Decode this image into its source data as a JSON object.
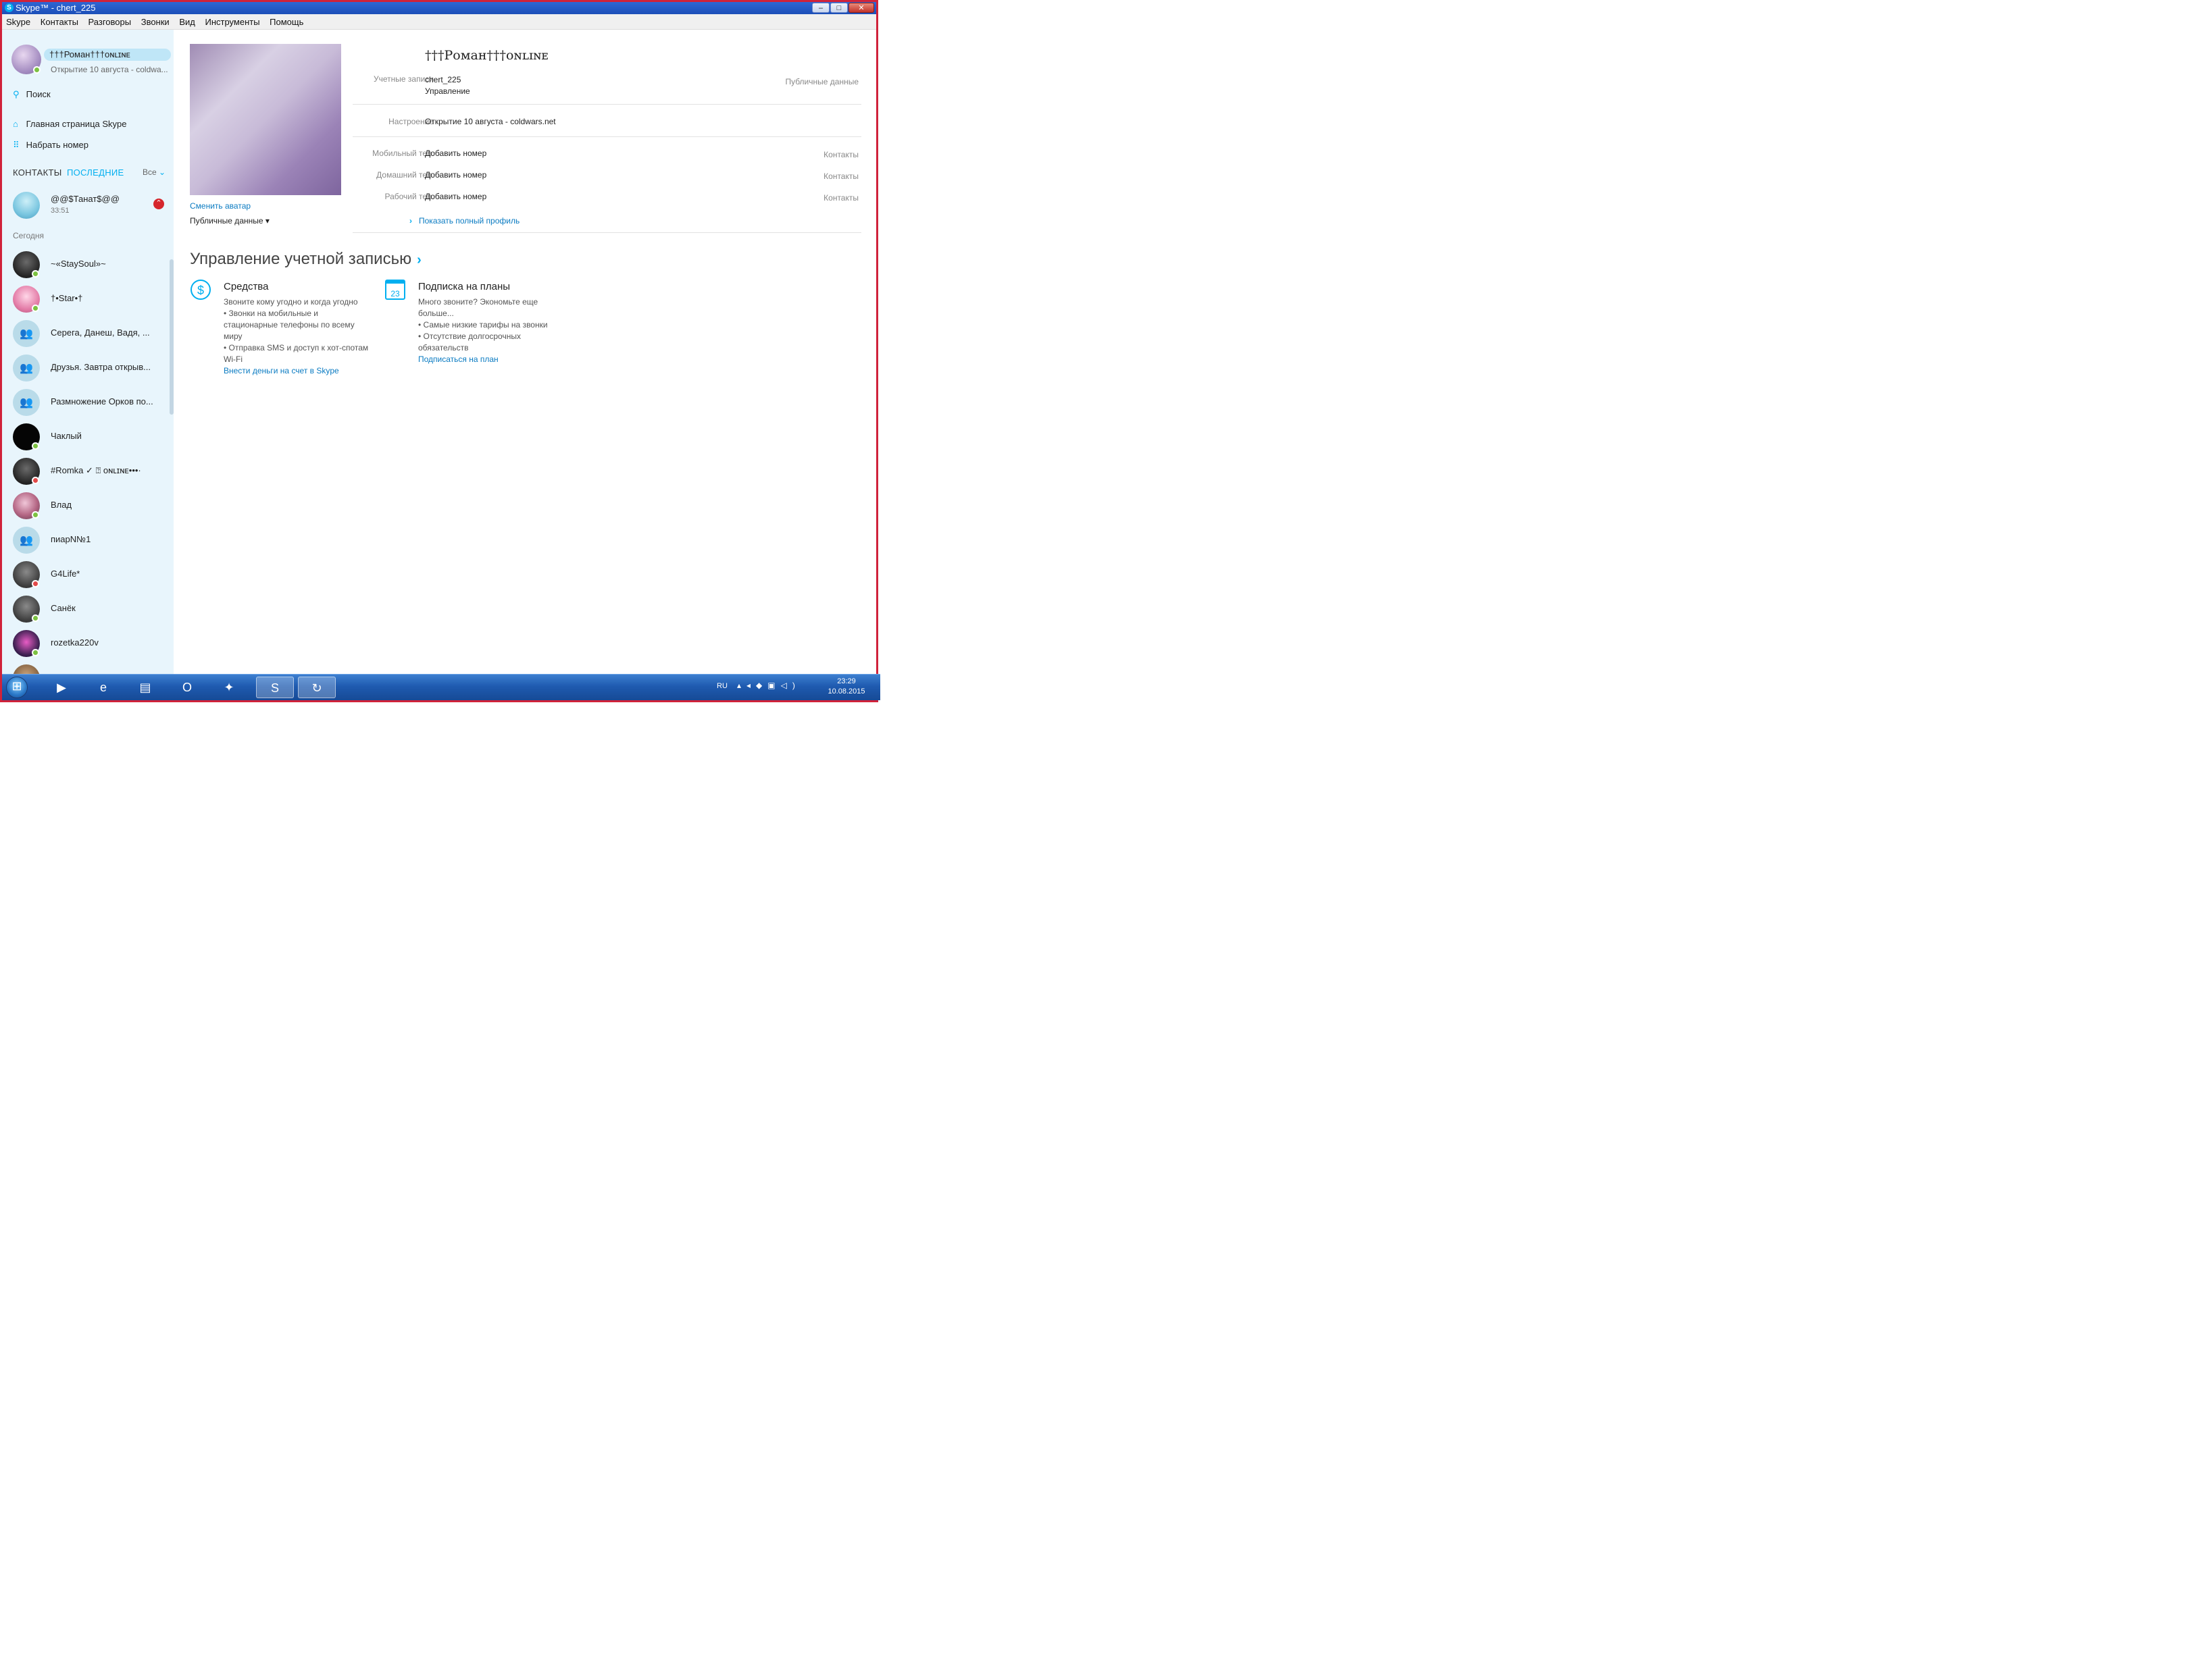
{
  "window": {
    "title": "Skype™ - chert_225",
    "min": "–",
    "max": "□",
    "close": "✕"
  },
  "menu": [
    "Skype",
    "Контакты",
    "Разговоры",
    "Звонки",
    "Вид",
    "Инструменты",
    "Помощь"
  ],
  "me": {
    "name": "†††Роман†††ᴏɴʟɪɴᴇ",
    "mood": "Открытие 10 августа - coldwa..."
  },
  "sidebar": {
    "search": "Поиск",
    "home": "Главная страница Skype",
    "dial": "Набрать номер",
    "tab_contacts": "КОНТАКТЫ",
    "tab_recent": "ПОСЛЕДНИЕ",
    "filter": "Все",
    "recent_top": {
      "name": "@@$Танат$@@",
      "time": "33:51"
    },
    "today": "Сегодня",
    "contacts": [
      {
        "name": "~«StaySoul»~",
        "status": "online",
        "avatar": "dark"
      },
      {
        "name": "†•Star•†",
        "status": "online",
        "avatar": "pink"
      },
      {
        "name": "Серега, Данеш, Вадя, ...",
        "status": "none",
        "avatar": "group"
      },
      {
        "name": "Друзья.  Завтра открыв...",
        "status": "none",
        "avatar": "group"
      },
      {
        "name": "Размножение Орков по...",
        "status": "none",
        "avatar": "group"
      },
      {
        "name": "Чаклый",
        "status": "online",
        "avatar": "black"
      },
      {
        "name": "#Romka ✓ ⍰ ᴏɴʟɪɴᴇ•••·",
        "status": "dnd",
        "avatar": "dark"
      },
      {
        "name": "Влад",
        "status": "online",
        "avatar": "mixed"
      },
      {
        "name": "пиарN№1",
        "status": "none",
        "avatar": "group"
      },
      {
        "name": "G4Life*",
        "status": "dnd",
        "avatar": "photo"
      },
      {
        "name": "Санёк",
        "status": "online",
        "avatar": "photo"
      },
      {
        "name": "rozetka220v",
        "status": "online",
        "avatar": "neon"
      },
      {
        "name": "",
        "status": "none",
        "avatar": "brown"
      }
    ]
  },
  "profile": {
    "name": "†††Роман†††ᴏɴʟɪɴᴇ",
    "accounts_label": "Учетные записи",
    "login": "chert_225",
    "manage": "Управление",
    "public_right": "Публичные данные",
    "mood_label": "Настроение",
    "mood": "Открытие 10 августа - coldwars.net",
    "mobile_label": "Мобильный тел.",
    "home_label": "Домашний тел.",
    "work_label": "Рабочий тел.",
    "add_number": "Добавить номер",
    "contacts_right": "Контакты",
    "change_avatar": "Сменить аватар",
    "public_data": "Публичные данные ▾",
    "show_full": "Показать полный профиль"
  },
  "account": {
    "title": "Управление учетной записью",
    "credit": {
      "title": "Средства",
      "lines": [
        "Звоните кому угодно и когда угодно",
        "• Звонки на мобильные и",
        "стационарные телефоны по всему",
        "миру",
        "• Отправка SMS и доступ к хот-спотам",
        "Wi-Fi"
      ],
      "link": "Внести деньги на счет в Skype"
    },
    "plans": {
      "title": "Подписка на планы",
      "calendar_day": "23",
      "lines": [
        "Много звоните? Экономьте еще",
        "больше...",
        "• Самые низкие тарифы на звонки",
        "• Отсутствие долгосрочных",
        "обязательств"
      ],
      "link": "Подписаться на план"
    }
  },
  "taskbar": {
    "lang": "RU",
    "time": "23:29",
    "date": "10.08.2015",
    "apps": [
      "media-player",
      "internet-explorer",
      "file-explorer",
      "opera",
      "game",
      "skype",
      "app"
    ]
  }
}
